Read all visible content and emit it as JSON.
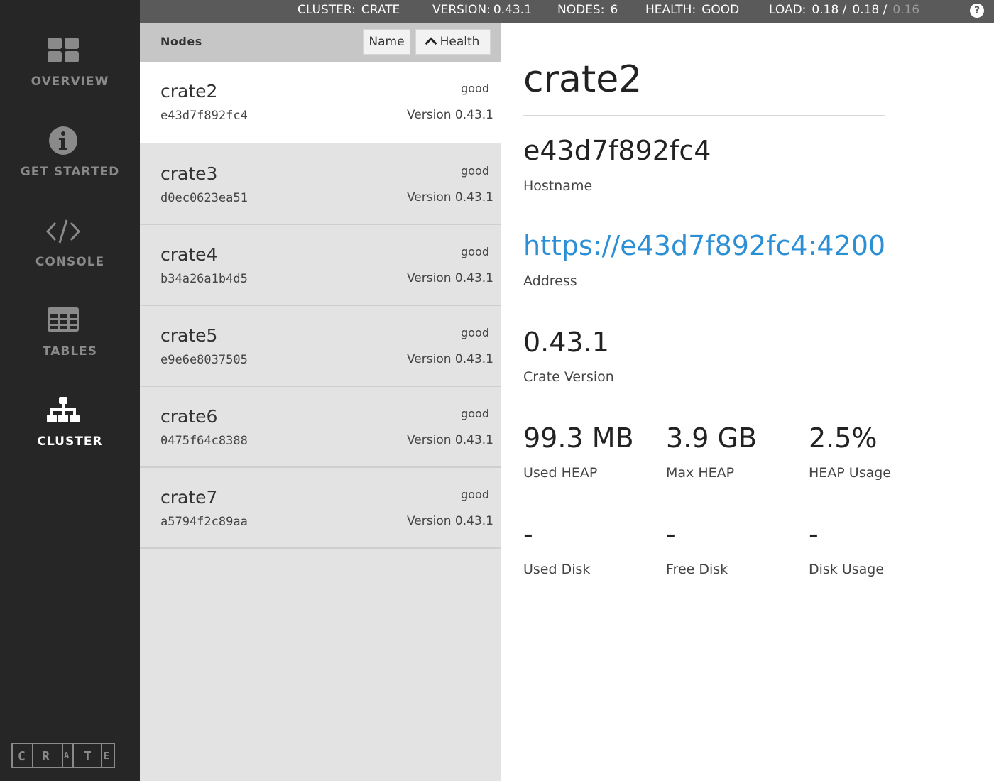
{
  "topbar": {
    "cluster_label": "CLUSTER:",
    "cluster_value": "CRATE",
    "version_label": "VERSION:",
    "version_value": "0.43.1",
    "nodes_label": "NODES:",
    "nodes_value": "6",
    "health_label": "HEALTH:",
    "health_value": "GOOD",
    "load_label": "LOAD:",
    "load_1": "0.18 /",
    "load_5": "0.18 /",
    "load_15": "0.16",
    "help": "?"
  },
  "sidebar": {
    "items": [
      {
        "label": "OVERVIEW",
        "icon": "grid-icon"
      },
      {
        "label": "GET STARTED",
        "icon": "info-icon"
      },
      {
        "label": "CONSOLE",
        "icon": "code-icon"
      },
      {
        "label": "TABLES",
        "icon": "table-icon"
      },
      {
        "label": "CLUSTER",
        "icon": "cluster-icon",
        "active": true
      }
    ],
    "logo_letters": [
      "C",
      "R",
      "A",
      "T",
      "E"
    ]
  },
  "nodes": {
    "title": "Nodes",
    "sort_name": "Name",
    "sort_health": "Health",
    "items": [
      {
        "name": "crate2",
        "hash": "e43d7f892fc4",
        "health": "good",
        "version": "Version 0.43.1"
      },
      {
        "name": "crate3",
        "hash": "d0ec0623ea51",
        "health": "good",
        "version": "Version 0.43.1"
      },
      {
        "name": "crate4",
        "hash": "b34a26a1b4d5",
        "health": "good",
        "version": "Version 0.43.1"
      },
      {
        "name": "crate5",
        "hash": "e9e6e8037505",
        "health": "good",
        "version": "Version 0.43.1"
      },
      {
        "name": "crate6",
        "hash": "0475f64c8388",
        "health": "good",
        "version": "Version 0.43.1"
      },
      {
        "name": "crate7",
        "hash": "a5794f2c89aa",
        "health": "good",
        "version": "Version 0.43.1"
      }
    ]
  },
  "detail": {
    "title": "crate2",
    "hostname_value": "e43d7f892fc4",
    "hostname_label": "Hostname",
    "address_value": "https://e43d7f892fc4:4200",
    "address_label": "Address",
    "version_value": "0.43.1",
    "version_label": "Crate Version",
    "used_heap_value": "99.3 MB",
    "used_heap_label": "Used HEAP",
    "max_heap_value": "3.9 GB",
    "max_heap_label": "Max HEAP",
    "heap_usage_value": "2.5%",
    "heap_usage_label": "HEAP Usage",
    "used_disk_value": "-",
    "used_disk_label": "Used Disk",
    "free_disk_value": "-",
    "free_disk_label": "Free Disk",
    "disk_usage_value": "-",
    "disk_usage_label": "Disk Usage"
  },
  "colors": {
    "sidebar_bg": "#262626",
    "topbar_bg": "#5a5a5a",
    "link": "#2b8fd6",
    "list_bg": "#e3e3e3"
  }
}
